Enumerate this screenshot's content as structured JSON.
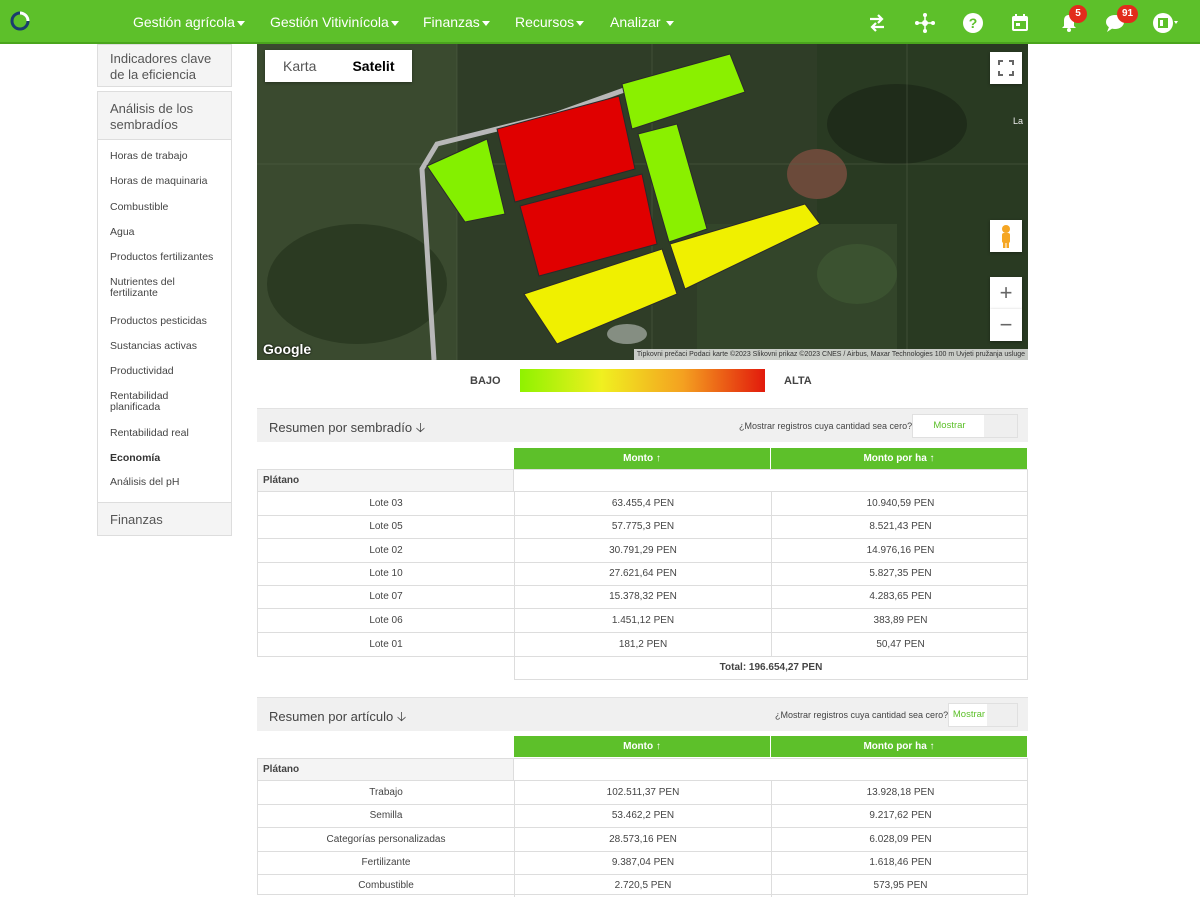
{
  "nav": {
    "items": [
      {
        "label": "Gestión agrícola"
      },
      {
        "label": "Gestión Vitivinícola"
      },
      {
        "label": "Finanzas"
      },
      {
        "label": "Recursos"
      },
      {
        "label": "Analizar"
      }
    ],
    "badges": {
      "notifications": "5",
      "messages": "91"
    },
    "icons": [
      "transfer-icon",
      "network-icon",
      "help-icon",
      "calendar-icon",
      "bell-icon",
      "chat-icon",
      "user-menu-icon"
    ],
    "accent": "#5dc02a"
  },
  "sidebar": {
    "box1": "Indicadores clave de la eficiencia",
    "box2": "Análisis de los sembradíos",
    "links": [
      "Horas de trabajo",
      "Horas de maquinaria",
      "Combustible",
      "Agua",
      "Productos fertilizantes",
      "Nutrientes del fertilizante",
      "Productos pesticidas",
      "Sustancias activas",
      "Productividad",
      "Rentabilidad planificada",
      "Rentabilidad real",
      "Economía",
      "Análisis del pH"
    ],
    "box3": "Finanzas"
  },
  "map": {
    "toggle_map": "Karta",
    "toggle_satellite": "Satelit",
    "google": "Google",
    "attribution": "Tipkovni prečaci   Podaci karte ©2023 Slikovni prikaz ©2023 CNES / Airbus, Maxar Technologies   100 m   Uvjeti pružanja usluge",
    "corner_text": "La",
    "zoom_in": "+",
    "zoom_out": "−"
  },
  "legend": {
    "low": "BAJO",
    "high": "ALTA"
  },
  "section1": {
    "title": "Resumen por sembradío",
    "question": "¿Mostrar registros cuya cantidad sea cero?",
    "button": "Mostrar",
    "col_amount": "Monto ↑",
    "col_per_ha": "Monto por ha ↑",
    "group": "Plátano",
    "rows": [
      {
        "name": "Lote 03",
        "amount": "63.455,4 PEN",
        "per_ha": "10.940,59 PEN"
      },
      {
        "name": "Lote 05",
        "amount": "57.775,3 PEN",
        "per_ha": "8.521,43 PEN"
      },
      {
        "name": "Lote 02",
        "amount": "30.791,29 PEN",
        "per_ha": "14.976,16 PEN"
      },
      {
        "name": "Lote 10",
        "amount": "27.621,64 PEN",
        "per_ha": "5.827,35 PEN"
      },
      {
        "name": "Lote 07",
        "amount": "15.378,32 PEN",
        "per_ha": "4.283,65 PEN"
      },
      {
        "name": "Lote 06",
        "amount": "1.451,12 PEN",
        "per_ha": "383,89 PEN"
      },
      {
        "name": "Lote 01",
        "amount": "181,2 PEN",
        "per_ha": "50,47 PEN"
      }
    ],
    "total": "Total: 196.654,27 PEN"
  },
  "section2": {
    "title": "Resumen por artículo",
    "question": "¿Mostrar registros cuya cantidad sea cero?",
    "button": "Mostrar",
    "col_amount": "Monto ↑",
    "col_per_ha": "Monto por ha ↑",
    "group": "Plátano",
    "rows": [
      {
        "name": "Trabajo",
        "amount": "102.511,37 PEN",
        "per_ha": "13.928,18 PEN"
      },
      {
        "name": "Semilla",
        "amount": "53.462,2 PEN",
        "per_ha": "9.217,62 PEN"
      },
      {
        "name": "Categorías personalizadas",
        "amount": "28.573,16 PEN",
        "per_ha": "6.028,09 PEN"
      },
      {
        "name": "Fertilizante",
        "amount": "9.387,04 PEN",
        "per_ha": "1.618,46 PEN"
      },
      {
        "name": "Combustible",
        "amount": "2.720,5 PEN",
        "per_ha": "573,95 PEN"
      }
    ]
  }
}
